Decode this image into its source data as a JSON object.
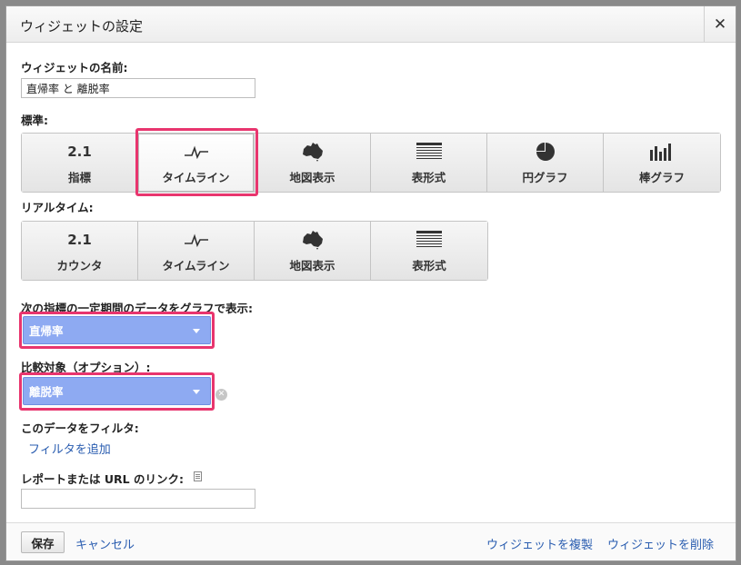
{
  "dialog": {
    "title": "ウィジェットの設定",
    "close_label": "✕"
  },
  "name_field": {
    "label": "ウィジェットの名前:",
    "value": "直帰率 と 離脱率"
  },
  "standard": {
    "label": "標準:",
    "buttons": [
      {
        "top": "2.1",
        "label": "指標",
        "icon": "number-icon"
      },
      {
        "label": "タイムライン",
        "icon": "timeline-icon",
        "selected": true
      },
      {
        "label": "地図表示",
        "icon": "australia-map-icon"
      },
      {
        "label": "表形式",
        "icon": "table-icon"
      },
      {
        "label": "円グラフ",
        "icon": "pie-chart-icon"
      },
      {
        "label": "棒グラフ",
        "icon": "bar-chart-icon"
      }
    ]
  },
  "realtime": {
    "label": "リアルタイム:",
    "buttons": [
      {
        "top": "2.1",
        "label": "カウンタ",
        "icon": "number-icon"
      },
      {
        "label": "タイムライン",
        "icon": "timeline-icon"
      },
      {
        "label": "地図表示",
        "icon": "australia-map-icon"
      },
      {
        "label": "表形式",
        "icon": "table-icon"
      }
    ]
  },
  "metric": {
    "label": "次の指標の一定期間のデータをグラフで表示:",
    "selected": "直帰率"
  },
  "compare": {
    "label": "比較対象（オプション）:",
    "selected": "離脱率"
  },
  "filter": {
    "label": "このデータをフィルタ:",
    "add_link": "フィルタを追加"
  },
  "link_field": {
    "label": "レポートまたは URL のリンク:",
    "value": ""
  },
  "footer": {
    "save": "保存",
    "cancel": "キャンセル",
    "duplicate": "ウィジェットを複製",
    "delete": "ウィジェットを削除"
  },
  "colors": {
    "highlight": "#e8356e",
    "select_bg": "#8eaaf2",
    "link": "#2a5db0"
  }
}
